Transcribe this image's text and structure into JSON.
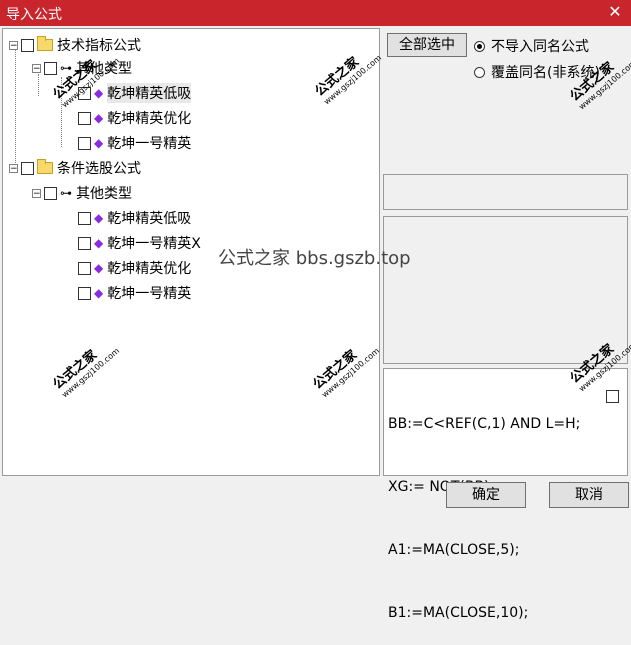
{
  "window": {
    "title": "导入公式",
    "close_glyph": "✕"
  },
  "tree": {
    "root1": {
      "label": "技术指标公式"
    },
    "child1": {
      "label": "其他类型"
    },
    "items1": [
      "乾坤精英低吸",
      "乾坤精英优化",
      "乾坤一号精英"
    ],
    "root2": {
      "label": "条件选股公式"
    },
    "child2": {
      "label": "其他类型"
    },
    "items2": [
      "乾坤精英低吸",
      "乾坤一号精英X",
      "乾坤精英优化",
      "乾坤一号精英"
    ]
  },
  "right": {
    "select_all": "全部选中",
    "radio_no_import": "不导入同名公式",
    "radio_overwrite": "覆盖同名(非系统)"
  },
  "code_lines": [
    "BB:=C<REF(C,1) AND L=H;",
    "XG:= NOT(BB);",
    "A1:=MA(CLOSE,5);",
    "B1:=MA(CLOSE,10);"
  ],
  "footer": {
    "ok": "确定",
    "cancel": "取消"
  },
  "watermark": {
    "main": "公式之家",
    "sub": "www.gszj100.com",
    "center": "公式之家 bbs.gszb.top"
  }
}
